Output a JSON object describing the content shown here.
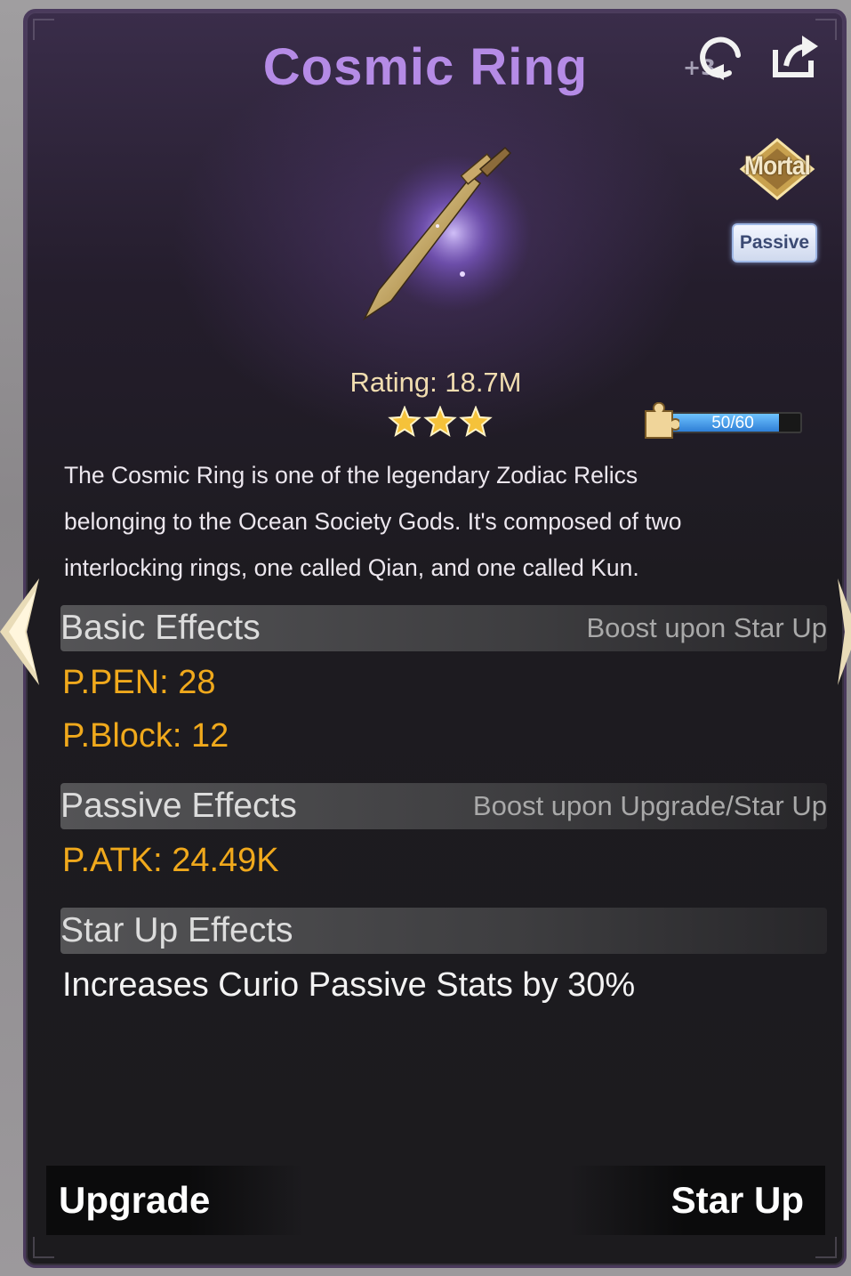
{
  "item": {
    "name": "Cosmic Ring",
    "refresh_count": "+3",
    "rank": "Mortal",
    "type": "Passive",
    "rating": "Rating: 18.7M",
    "stars": 3,
    "fragments": {
      "label": "50/60",
      "current": 50,
      "max": 60
    },
    "description": [
      "The Cosmic Ring is one of the legendary Zodiac Relics",
      "belonging to the Ocean Society Gods. It's composed of two",
      "interlocking rings, one called Qian, and one called Kun."
    ]
  },
  "basic_effects": {
    "title": "Basic Effects",
    "note": "Boost upon Star Up",
    "stats": [
      "P.PEN: 28",
      "P.Block: 12"
    ]
  },
  "passive_effects": {
    "title": "Passive Effects",
    "note": "Boost upon Upgrade/Star Up",
    "stats": [
      "P.ATK: 24.49K"
    ]
  },
  "star_up_effects": {
    "title": "Star Up Effects",
    "text": "Increases Curio Passive Stats by 30%"
  },
  "buttons": {
    "upgrade": "Upgrade",
    "star_up": "Star Up"
  },
  "icons": {
    "refresh": "refresh-icon",
    "share": "share-icon",
    "fragment": "puzzle-piece-icon",
    "star": "star-icon",
    "prev": "chevron-left-icon",
    "next": "chevron-right-icon"
  },
  "colors": {
    "title": "#b58be6",
    "stat": "#f0a91c",
    "rating": "#f1ddb0",
    "fragment_fill": "#3d94e8"
  }
}
